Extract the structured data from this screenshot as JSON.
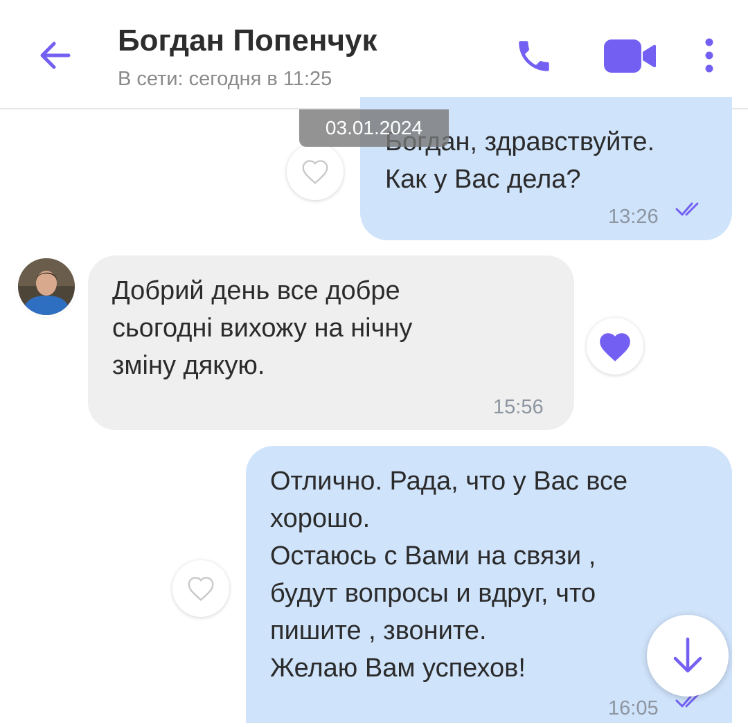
{
  "header": {
    "contact_name": "Богдан Попенчук",
    "status": "В сети: сегодня в 11:25",
    "icons": {
      "back": "arrow-left-icon",
      "call": "phone-icon",
      "video": "video-camera-icon",
      "more": "more-vertical-icon"
    },
    "accent_color": "#7360f2"
  },
  "date_chip": "03.01.2024",
  "messages": [
    {
      "direction": "outgoing",
      "text": "Богдан, здравствуйте.\nКак у Вас дела?",
      "time": "13:26",
      "status_icon": "double-check-icon",
      "reaction": "heart-outline-icon",
      "reacted": false
    },
    {
      "direction": "incoming",
      "text": "Добрий день все добре\nсьогодні вихожу на нічну\nзміну дякую.",
      "time": "15:56",
      "reaction": "heart-filled-icon",
      "reacted": true,
      "avatar_icon": "user-avatar"
    },
    {
      "direction": "outgoing",
      "text": "Отлично. Рада, что у Вас все\nхорошо.\nОстаюсь с Вами на связи ,\nбудут вопросы и вдруг, что\nпишите , звоните.\nЖелаю Вам успехов!",
      "time": "16:05",
      "status_icon": "double-check-icon",
      "reaction": "heart-outline-icon",
      "reacted": false
    }
  ],
  "scroll_down_icon": "arrow-down-icon",
  "colors": {
    "outgoing_bubble": "#cfe3fb",
    "incoming_bubble": "#efefef",
    "accent": "#7360f2"
  }
}
